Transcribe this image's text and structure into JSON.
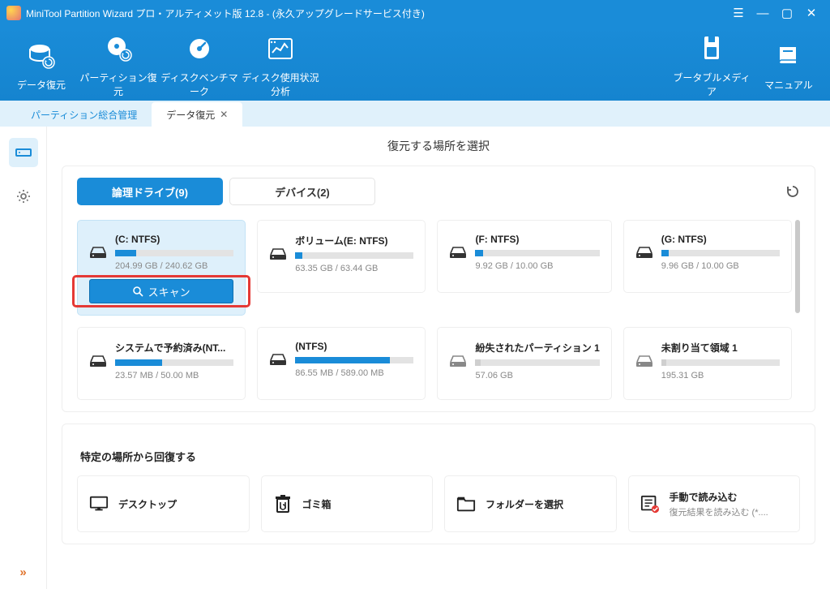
{
  "title": "MiniTool Partition Wizard プロ・アルティメット版 12.8 - (永久アップグレードサービス付き)",
  "toolbar": {
    "data_recovery": "データ復元",
    "partition_recovery": "パーティション復元",
    "disk_benchmark": "ディスクベンチマーク",
    "disk_usage": "ディスク使用状況分析",
    "bootable_media": "ブータブルメディア",
    "manual": "マニュアル"
  },
  "tabs": {
    "partition_mgmt": "パーティション総合管理",
    "data_recovery": "データ復元"
  },
  "page_title": "復元する場所を選択",
  "subtabs": {
    "logical": "論理ドライブ(9)",
    "devices": "デバイス(2)"
  },
  "scan_label": "スキャン",
  "drives": [
    {
      "name": "(C: NTFS)",
      "size": "204.99 GB / 240.62 GB",
      "fill": 18
    },
    {
      "name": "ボリューム(E: NTFS)",
      "size": "63.35 GB / 63.44 GB",
      "fill": 6
    },
    {
      "name": "(F: NTFS)",
      "size": "9.92 GB / 10.00 GB",
      "fill": 6
    },
    {
      "name": "(G: NTFS)",
      "size": "9.96 GB / 10.00 GB",
      "fill": 6
    },
    {
      "name": "システムで予約済み(NT...",
      "size": "23.57 MB / 50.00 MB",
      "fill": 40
    },
    {
      "name": "(NTFS)",
      "size": "86.55 MB / 589.00 MB",
      "fill": 80
    },
    {
      "name": "紛失されたパーティション 1",
      "size": "57.06 GB",
      "fill": 4
    },
    {
      "name": "未割り当て領域 1",
      "size": "195.31 GB",
      "fill": 4
    }
  ],
  "recover_section": "特定の場所から回復する",
  "locations": {
    "desktop": "デスクトップ",
    "trash": "ゴミ箱",
    "folder": "フォルダーを選択",
    "manual_load": "手動で読み込む",
    "manual_load_sub": "復元結果を読み込む (*...."
  }
}
